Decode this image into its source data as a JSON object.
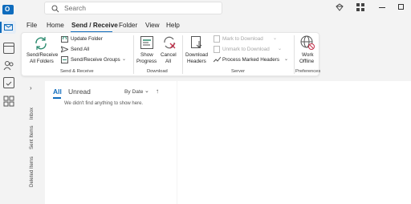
{
  "titlebar": {
    "search_placeholder": "Search"
  },
  "menu": {
    "tabs": [
      "File",
      "Home",
      "Send / Receive",
      "Folder",
      "View",
      "Help"
    ],
    "active": "Send / Receive"
  },
  "ribbon": {
    "send_receive_all": [
      "Send/Receive",
      "All Folders"
    ],
    "update_folder": "Update Folder",
    "send_all": "Send All",
    "send_receive_groups": "Send/Receive Groups",
    "show_progress": [
      "Show",
      "Progress"
    ],
    "cancel_all": [
      "Cancel",
      "All"
    ],
    "download_headers": [
      "Download",
      "Headers"
    ],
    "mark_to_download": "Mark to Download",
    "unmark_to_download": "Unmark to Download",
    "process_marked_headers": "Process Marked Headers",
    "work_offline": [
      "Work",
      "Offline"
    ],
    "groups": [
      "Send & Receive",
      "Download",
      "Server",
      "Preferences"
    ]
  },
  "folder_pane": {
    "items": [
      "Inbox",
      "Sent Items",
      "Deleted Items"
    ]
  },
  "message_list": {
    "tabs": [
      "All",
      "Unread"
    ],
    "sort_label": "By Date",
    "empty_text": "We didn't find anything to show here."
  },
  "colors": {
    "accent": "#0f6cbd",
    "app_bg": "#f3f3f3"
  }
}
